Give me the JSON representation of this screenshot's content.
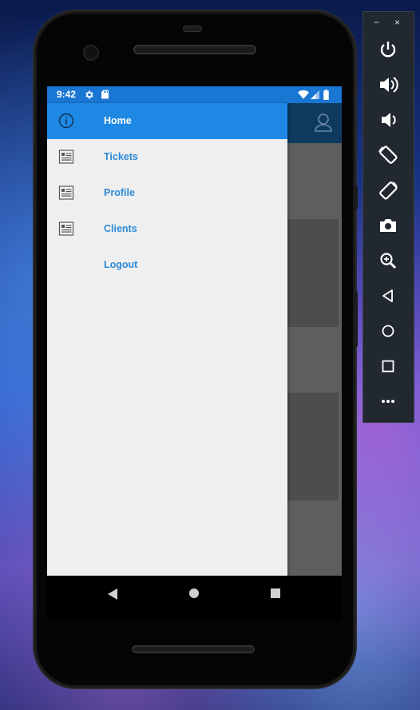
{
  "status_bar": {
    "time": "9:42",
    "icons": [
      "settings-icon",
      "sd-card-icon",
      "wifi-icon",
      "signal-icon",
      "battery-icon"
    ]
  },
  "drawer": {
    "items": [
      {
        "label": "Home",
        "icon": "info-icon",
        "active": true
      },
      {
        "label": "Tickets",
        "icon": "list-icon",
        "active": false
      },
      {
        "label": "Profile",
        "icon": "list-icon",
        "active": false
      },
      {
        "label": "Clients",
        "icon": "list-icon",
        "active": false
      },
      {
        "label": "Logout",
        "icon": "",
        "active": false
      }
    ]
  },
  "app_bar": {
    "icon": "user-icon"
  },
  "nav_bar": {
    "icons": [
      "back-icon",
      "home-icon",
      "recents-icon"
    ]
  },
  "emulator_panel": {
    "window_controls": [
      "−",
      "×"
    ],
    "buttons": [
      "power-icon",
      "volume-up-icon",
      "volume-down-icon",
      "rotate-left-icon",
      "rotate-right-icon",
      "camera-icon",
      "zoom-icon",
      "back-icon",
      "home-icon",
      "overview-icon",
      "more-icon"
    ]
  },
  "colors": {
    "status_bar": "#1976d2",
    "app_bar": "#0e3a60",
    "drawer_active": "#1e88e5",
    "drawer_bg": "#efefef",
    "drawer_label": "#2a8ad8",
    "emulator_panel": "#212830"
  }
}
